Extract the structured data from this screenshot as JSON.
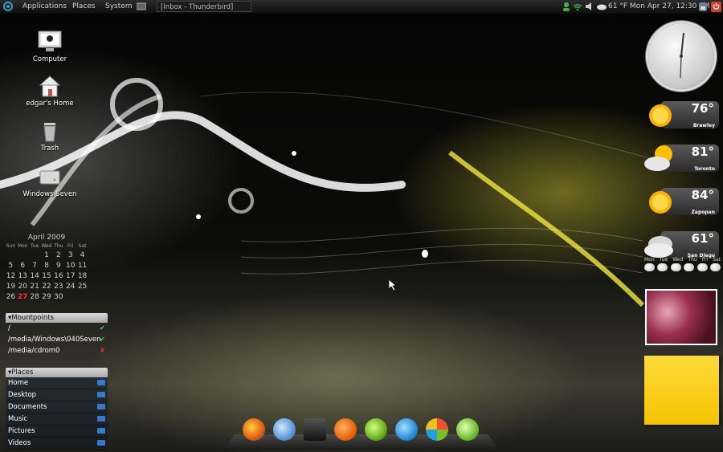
{
  "topbar": {
    "menus": [
      "Applications",
      "Places",
      "System"
    ],
    "window_title": "[Inbox - Thunderbird]",
    "weather": "61 °F",
    "datetime": "Mon Apr 27, 12:30 PM"
  },
  "desktop_icons": [
    {
      "label": "Computer",
      "icon": "computer-icon"
    },
    {
      "label": "edgar's Home",
      "icon": "home-folder-icon"
    },
    {
      "label": "Trash",
      "icon": "trash-icon"
    },
    {
      "label": "Windows Seven",
      "icon": "drive-icon"
    }
  ],
  "calendar": {
    "title": "April 2009",
    "weekdays": [
      "Sun",
      "Mon",
      "Tue",
      "Wed",
      "Thu",
      "Fri",
      "Sat"
    ],
    "weeks": [
      [
        "",
        "",
        "",
        "1",
        "2",
        "3",
        "4"
      ],
      [
        "5",
        "6",
        "7",
        "8",
        "9",
        "10",
        "11"
      ],
      [
        "12",
        "13",
        "14",
        "15",
        "16",
        "17",
        "18"
      ],
      [
        "19",
        "20",
        "21",
        "22",
        "23",
        "24",
        "25"
      ],
      [
        "26",
        "27",
        "28",
        "29",
        "30",
        "",
        ""
      ]
    ],
    "today": "27"
  },
  "mountpoints": {
    "title": "▾Mountpoints",
    "items": [
      {
        "path": "/",
        "status": "✔",
        "color": "#4fd04f"
      },
      {
        "path": "/media/Windows\\040Seven",
        "status": "✔",
        "color": "#4fd04f"
      },
      {
        "path": "/media/cdrom0",
        "status": "✘",
        "color": "#e03030"
      }
    ]
  },
  "places": {
    "title": "▾Places",
    "items": [
      "Home",
      "Desktop",
      "Documents",
      "Music",
      "Pictures",
      "Videos"
    ]
  },
  "weather": [
    {
      "temp": "76°",
      "city": "Brawley",
      "icon": "sun-icon"
    },
    {
      "temp": "81°",
      "city": "Toronto",
      "icon": "partly-cloudy-icon"
    },
    {
      "temp": "84°",
      "city": "Zapopan",
      "icon": "sun-icon"
    },
    {
      "temp": "61°",
      "city": "San Diego",
      "icon": "cloudy-icon"
    }
  ],
  "forecast_days": [
    "Mon",
    "Tue",
    "Wed",
    "Thu",
    "Fri",
    "Sat"
  ],
  "dock_icons": [
    "firefox-icon",
    "globe-icon",
    "terminal-icon",
    "update-icon",
    "chat-icon",
    "skype-icon",
    "messenger-icon",
    "emesene-icon"
  ]
}
